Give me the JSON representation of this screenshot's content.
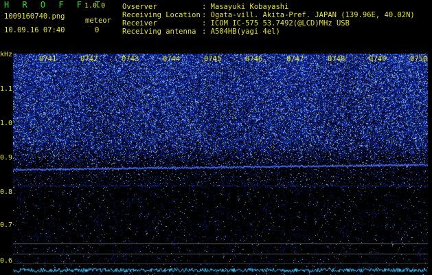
{
  "header": {
    "app_title": "H R O F F T",
    "version": "1.0.0",
    "filename": "1009160740.png",
    "meteor_label": "meteor",
    "datetime": "10.09.16 07:40",
    "meteor_count": "0"
  },
  "info": [
    {
      "label": "Ovserver",
      "value": ": Masayuki Kobayashi"
    },
    {
      "label": "Receiving Location",
      "value": ": Ogata-vill. Akita-Pref. JAPAN (139.96E, 40.02N)"
    },
    {
      "label": "Receiver",
      "value": ": ICOM IC-575 53.7492(@LCD)MHz USB"
    },
    {
      "label": "Receiving antenna",
      "value": ": A504HB(yagi 4el)"
    }
  ],
  "axis": {
    "unit": "kHz",
    "y_ticks": [
      "1.1",
      "1.0",
      "0.9",
      "0.8",
      "0.7",
      "0.6"
    ],
    "time_ticks": [
      "0741",
      "0742",
      "0743",
      "0744",
      "0745",
      "0746",
      "0747",
      "0748",
      "0749",
      "0750"
    ]
  },
  "colors": {
    "header_text": "#e6e619",
    "title_text": "#19e619",
    "noise": "#1f2fc0",
    "carrier": "#4060ff"
  }
}
